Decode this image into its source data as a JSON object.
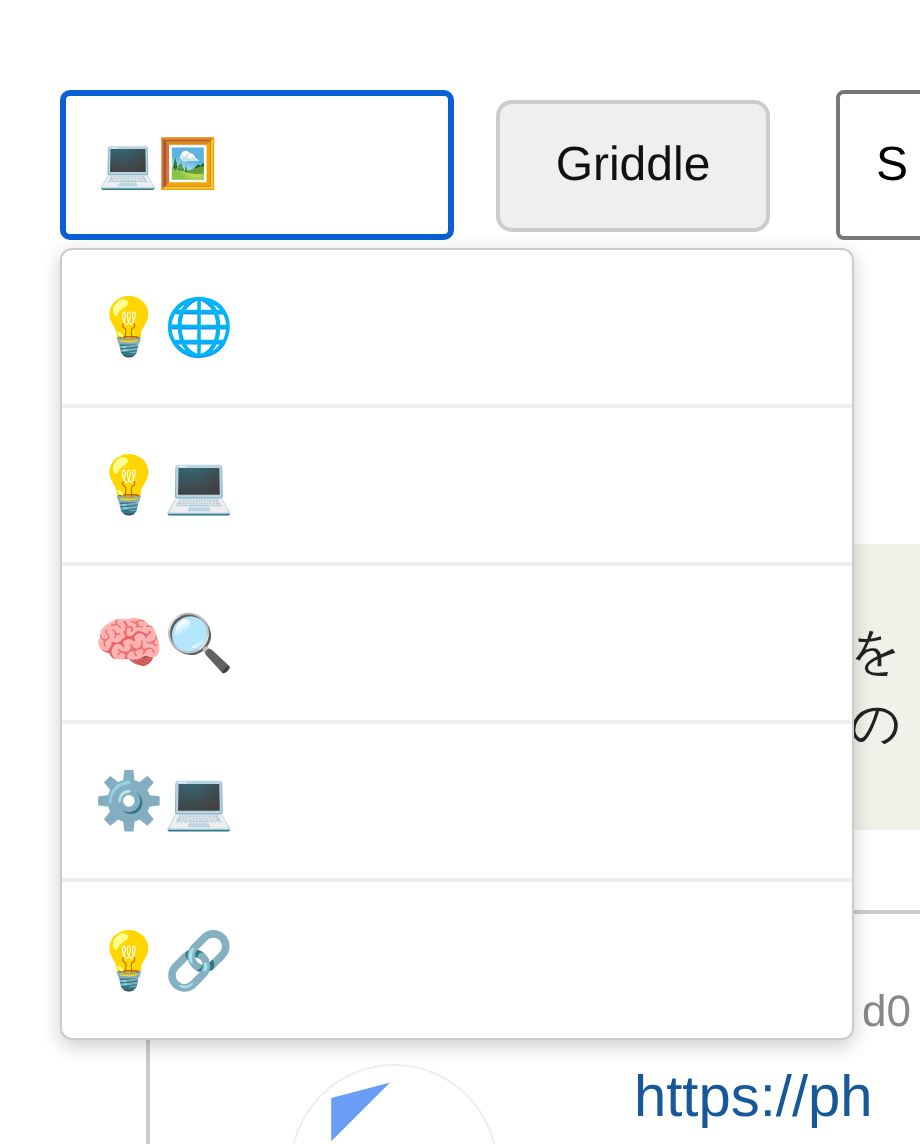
{
  "search": {
    "value": "💻🖼️"
  },
  "buttons": [
    {
      "label": "Griddle"
    },
    {
      "label": "S"
    }
  ],
  "suggestions": [
    {
      "label": "💡🌐"
    },
    {
      "label": "💡💻"
    },
    {
      "label": "🧠🔍"
    },
    {
      "label": "⚙️💻"
    },
    {
      "label": "💡🔗"
    }
  ],
  "background": {
    "snippet_lines": [
      "を",
      "の"
    ],
    "hash": "d0",
    "link": "https://ph"
  }
}
